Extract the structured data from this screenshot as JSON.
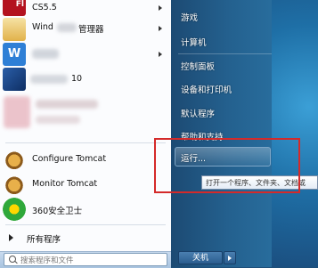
{
  "left": {
    "items": [
      {
        "label": "CS5.5",
        "icon": "flash-icon"
      },
      {
        "label": "Wind",
        "label_tail": "管理器",
        "icon": "window-manager-icon"
      },
      {
        "label": "",
        "icon": "wps-icon"
      },
      {
        "label": "10",
        "icon": "app-icon"
      }
    ],
    "pinned": [
      {
        "label": "Configure Tomcat",
        "icon": "tomcat-icon"
      },
      {
        "label": "Monitor Tomcat",
        "icon": "tomcat-icon"
      },
      {
        "label": "360安全卫士",
        "icon": "360-icon"
      }
    ],
    "all_programs": "所有程序",
    "search_placeholder": "搜索程序和文件"
  },
  "right": {
    "items": [
      "游戏",
      "计算机",
      "控制面板",
      "设备和打印机",
      "默认程序",
      "帮助和支持",
      "运行..."
    ],
    "shutdown": "关机"
  },
  "tooltip": "打开一个程序、文件夹、文档或",
  "colors": {
    "highlight_border": "#d42a2a",
    "right_pane": "#24618f"
  }
}
